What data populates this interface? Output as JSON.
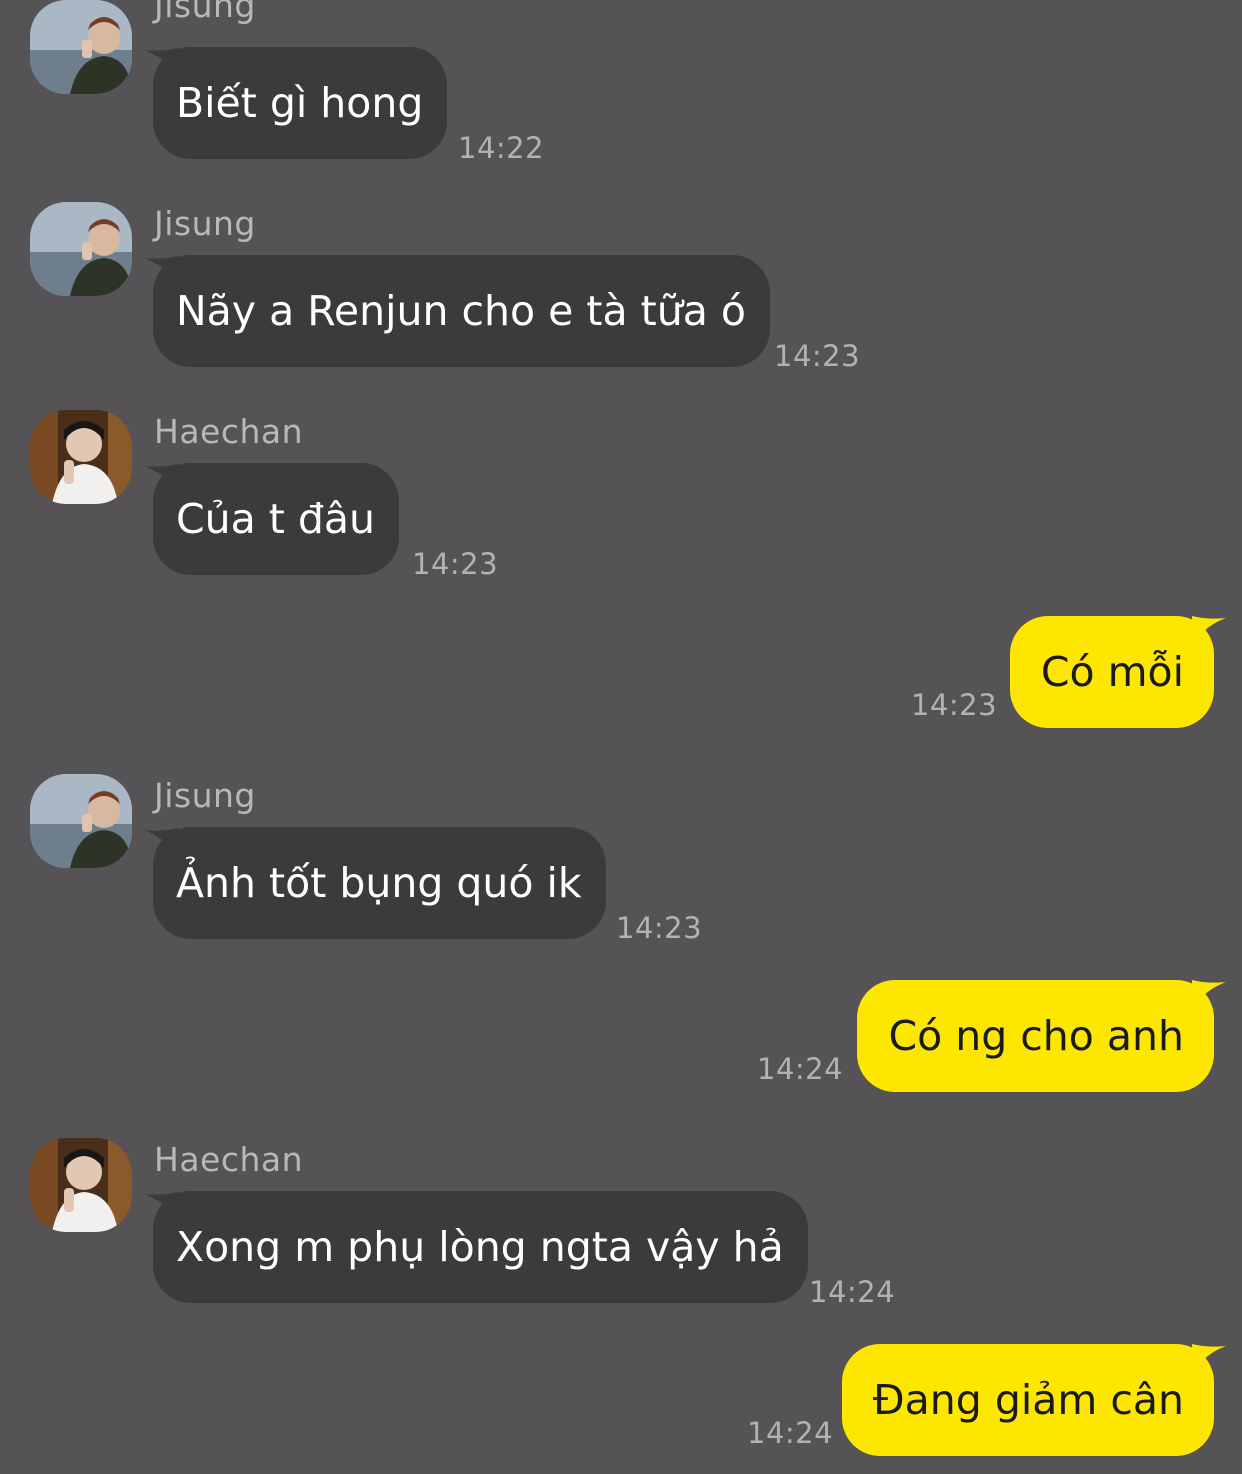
{
  "colors": {
    "background": "#555355",
    "incoming_bubble": "#3b3a3c",
    "outgoing_bubble": "#fde700",
    "meta_text": "#b3b1b3"
  },
  "messages": [
    {
      "sender": "Jisung",
      "avatar": "jisung-avatar",
      "text": "Biết gì hong",
      "time": "14:22"
    },
    {
      "sender": "Jisung",
      "avatar": "jisung-avatar",
      "text": "Nãy a Renjun cho e tà tữa ó",
      "time": "14:23"
    },
    {
      "sender": "Haechan",
      "avatar": "haechan-avatar",
      "text": "Của t đâu",
      "time": "14:23"
    },
    {
      "text": "Có mỗi",
      "time": "14:23"
    },
    {
      "sender": "Jisung",
      "avatar": "jisung-avatar",
      "text": "Ảnh tốt bụng quó ik",
      "time": "14:23"
    },
    {
      "text": "Có ng cho anh",
      "time": "14:24"
    },
    {
      "sender": "Haechan",
      "avatar": "haechan-avatar",
      "text": "Xong m phụ lòng ngta vậy hả",
      "time": "14:24"
    },
    {
      "text": "Đang giảm cân",
      "time": "14:24"
    }
  ]
}
